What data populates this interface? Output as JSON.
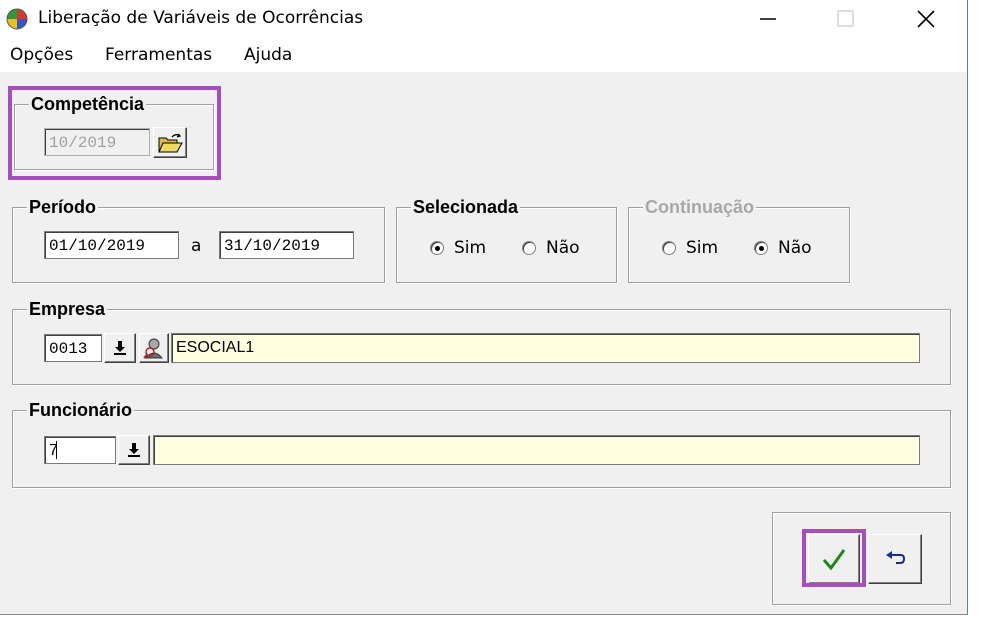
{
  "window": {
    "title": "Liberação de Variáveis de Ocorrências"
  },
  "menu": [
    "Opções",
    "Ferramentas",
    "Ajuda"
  ],
  "competencia": {
    "label": "Competência",
    "value": "10/2019"
  },
  "periodo": {
    "label": "Período",
    "start": "01/10/2019",
    "separator": "a",
    "end": "31/10/2019"
  },
  "selecionada": {
    "label": "Selecionada",
    "options": [
      "Sim",
      "Não"
    ],
    "selected": "Sim"
  },
  "continuacao": {
    "label": "Continuação",
    "options": [
      "Sim",
      "Não"
    ],
    "selected": "Não"
  },
  "empresa": {
    "label": "Empresa",
    "code": "0013",
    "name": "ESOCIAL1"
  },
  "funcionario": {
    "label": "Funcionário",
    "code": "7",
    "name": ""
  },
  "colors": {
    "highlight": "#a64dc1",
    "field_yellow": "#ffffe1",
    "confirm_green": "#1a8a1a",
    "undo_blue": "#1a2a9a"
  }
}
